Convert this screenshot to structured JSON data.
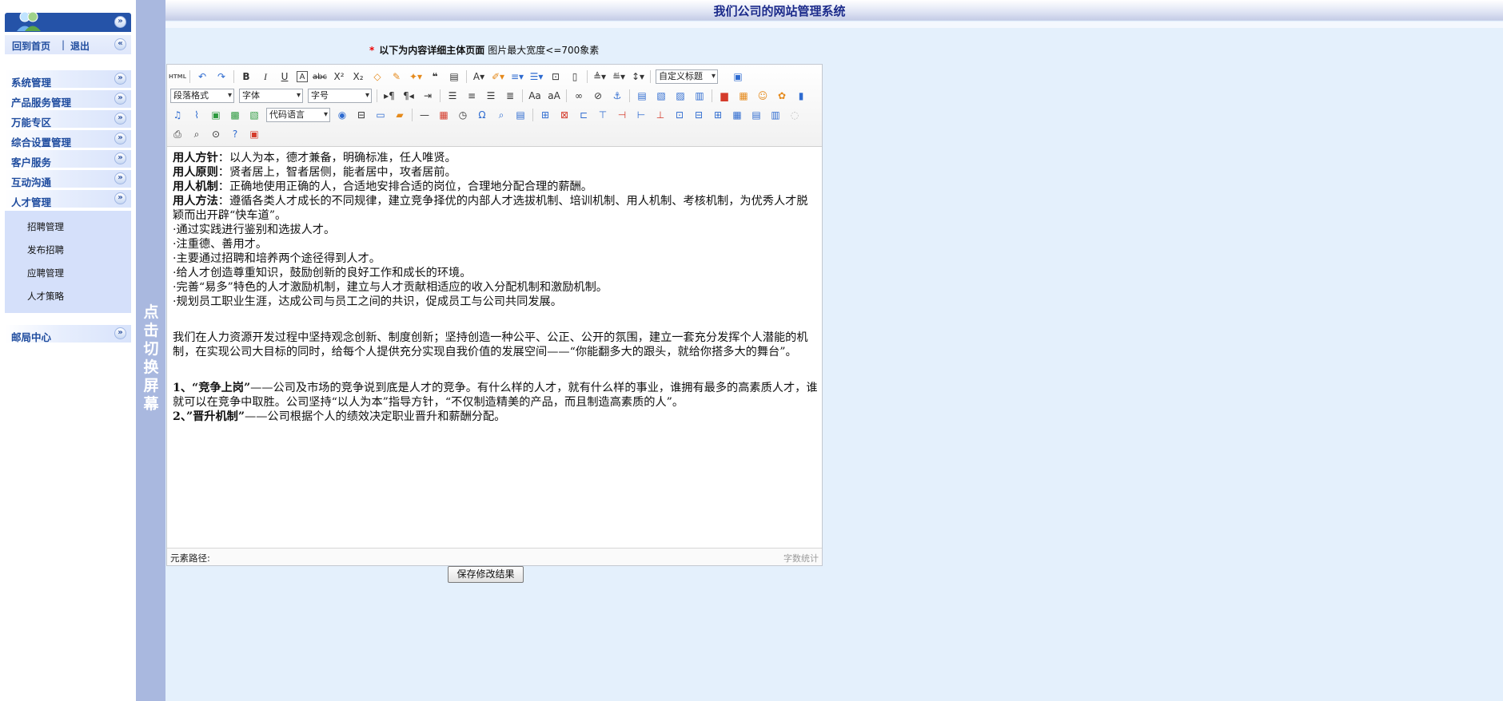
{
  "sidebar": {
    "top_links": {
      "home": "回到首页",
      "separator": "|",
      "logout": "退出"
    },
    "menu": [
      {
        "label": "系统管理"
      },
      {
        "label": "产品服务管理"
      },
      {
        "label": "万能专区"
      },
      {
        "label": "综合设置管理"
      },
      {
        "label": "客户服务"
      },
      {
        "label": "互动沟通"
      },
      {
        "label": "人才管理"
      }
    ],
    "submenu": [
      {
        "label": "招聘管理"
      },
      {
        "label": "发布招聘"
      },
      {
        "label": "应聘管理"
      },
      {
        "label": "人才策略"
      }
    ],
    "mail": {
      "label": "邮局中心"
    }
  },
  "switch_bar": {
    "text": "点击切换屏幕"
  },
  "header": {
    "title": "我们公司的网站管理系统"
  },
  "notice": {
    "star": "*",
    "bold_text": "以下为内容详细主体页面",
    "hint": "图片最大宽度<=700象素"
  },
  "toolbar": {
    "paragraph_format": "段落格式",
    "font_family": "字体",
    "font_size": "字号",
    "custom_heading": "自定义标题",
    "code_language": "代码语言",
    "html_icon": "HTML"
  },
  "content": {
    "lines": [
      {
        "label": "用人方针",
        "text": "：以人为本，德才兼备，明确标准，任人唯贤。"
      },
      {
        "label": "用人原则",
        "text": "：贤者居上，智者居侧，能者居中，攻者居前。"
      },
      {
        "label": "用人机制",
        "text": "：正确地使用正确的人，合适地安排合适的岗位，合理地分配合理的薪酬。"
      },
      {
        "label": "用人方法",
        "text": "：遵循各类人才成长的不同规律，建立竞争择优的内部人才选拔机制、培训机制、用人机制、考核机制，为优秀人才脱颖而出开辟“快车道”。"
      }
    ],
    "bullets": [
      "·通过实践进行鉴别和选拔人才。",
      "·注重德、善用才。",
      "·主要通过招聘和培养两个途径得到人才。",
      "·给人才创造尊重知识，鼓励创新的良好工作和成长的环境。",
      "·完善“易多”特色的人才激励机制，建立与人才贡献相适应的收入分配机制和激励机制。",
      "·规划员工职业生涯，达成公司与员工之间的共识，促成员工与公司共同发展。"
    ],
    "paragraph": "我们在人力资源开发过程中坚持观念创新、制度创新；坚持创造一种公平、公正、公开的氛围，建立一套充分发挥个人潜能的机制，在实现公司大目标的同时，给每个人提供充分实现自我价值的发展空间——“你能翻多大的跟头，就给你搭多大的舞台”。",
    "item1_label": "1、“竞争上岗”",
    "item1_text": "——公司及市场的竞争说到底是人才的竞争。有什么样的人才，就有什么样的事业，谁拥有最多的高素质人才，谁就可以在竞争中取胜。公司坚持“以人为本”指导方针，“不仅制造精美的产品，而且制造高素质的人”。",
    "item2_label": "2、”晋升机制”",
    "item2_text": "——公司根据个人的绩效决定职业晋升和薪酬分配。"
  },
  "statusbar": {
    "path_label": "元素路径:",
    "word_count": "字数统计"
  },
  "save_button": "保存修改结果"
}
